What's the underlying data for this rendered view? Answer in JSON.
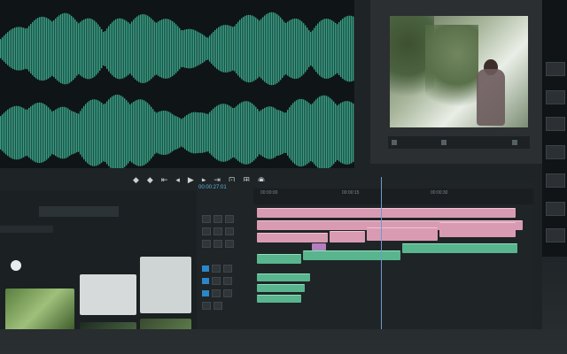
{
  "colors": {
    "waveform": "#3fb99a",
    "video_clip": "#d99bb2",
    "audio_clip": "#58b58e",
    "accent": "#2a87c9",
    "timecode": "#5cb3e0"
  },
  "timeline": {
    "timecode": "00:00:27:01",
    "ruler_marks": [
      "00:00:00",
      "00:00:15",
      "00:00:30"
    ]
  },
  "transport": {
    "buttons": [
      "mark-in",
      "mark-out",
      "go-to-in",
      "step-back",
      "play",
      "step-forward",
      "go-to-out",
      "insert",
      "overwrite",
      "export-frame"
    ]
  }
}
